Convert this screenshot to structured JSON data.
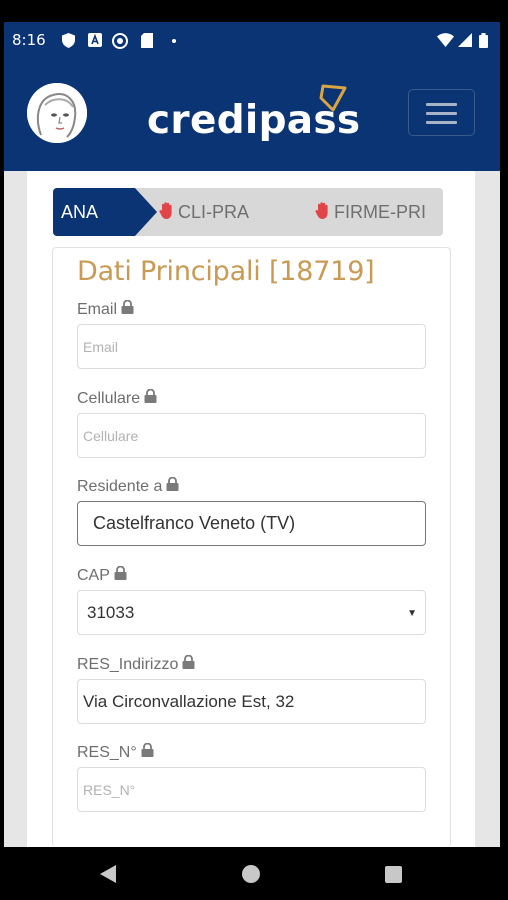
{
  "status_bar": {
    "time": "8:16",
    "icons": [
      "shield-icon",
      "a-box-icon",
      "vpn-icon",
      "sd-card-icon",
      "notification-dot-icon",
      "wifi-icon",
      "signal-icon",
      "battery-icon"
    ]
  },
  "header": {
    "brand": "credipass",
    "menu_icon": "hamburger-menu-icon",
    "avatar_icon": "user-avatar"
  },
  "steps": [
    {
      "label": "ANA",
      "state": "active"
    },
    {
      "label": "CLI-PRA",
      "state": "locked",
      "icon": "hand-stop-icon"
    },
    {
      "label": "FIRME-PRI",
      "state": "locked",
      "icon": "hand-stop-icon"
    }
  ],
  "form": {
    "title": "Dati Principali [18719]",
    "fields": {
      "email": {
        "label": "Email",
        "value": "",
        "placeholder": "Email"
      },
      "cellulare": {
        "label": "Cellulare",
        "value": "",
        "placeholder": "Cellulare"
      },
      "residente": {
        "label": "Residente a",
        "value": "Castelfranco Veneto (TV)"
      },
      "cap": {
        "label": "CAP",
        "value": "31033"
      },
      "indirizzo": {
        "label": "RES_Indirizzo",
        "value": "Via Circonvallazione Est, 32"
      },
      "numero": {
        "label": "RES_N°",
        "value": "",
        "placeholder": "RES_N°"
      }
    }
  },
  "colors": {
    "brand_blue": "#0a3473",
    "title_gold": "#c99a54",
    "step_inactive": "#d8d8d8"
  }
}
